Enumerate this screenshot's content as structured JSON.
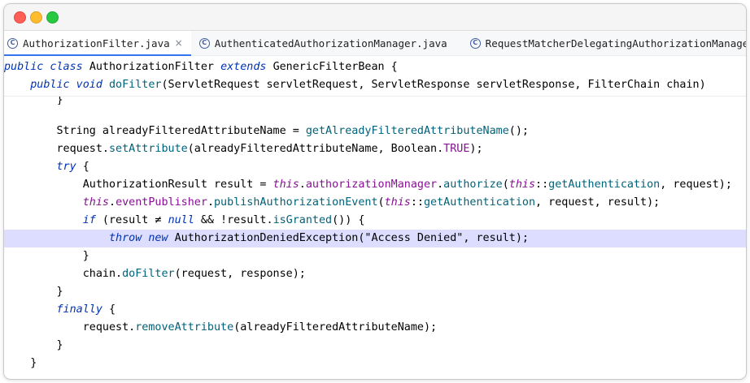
{
  "tabs": [
    {
      "label": "AuthorizationFilter.java",
      "active": true,
      "closable": true,
      "icon": "class-icon"
    },
    {
      "label": "AuthenticatedAuthorizationManager.java",
      "active": false,
      "closable": false,
      "icon": "class-icon"
    },
    {
      "label": "RequestMatcherDelegatingAuthorizationManager.java",
      "active": false,
      "closable": false,
      "icon": "class-icon"
    }
  ],
  "tab_icon_glyph": "C",
  "tab_close_glyph": "×",
  "colors": {
    "keyword": "#0033b3",
    "field": "#871094",
    "method": "#00627a",
    "string": "#067d17",
    "highlight": "#ddddff"
  },
  "sticky_lines": [
    [
      {
        "t": "public class ",
        "c": "kwi"
      },
      {
        "t": "AuthorizationFilter ",
        "c": "cls"
      },
      {
        "t": "extends ",
        "c": "kwi"
      },
      {
        "t": "GenericFilterBean {",
        "c": "cls"
      }
    ],
    [
      {
        "t": "    ",
        "c": "cls"
      },
      {
        "t": "public void ",
        "c": "kwi"
      },
      {
        "t": "doFilter",
        "c": "mth"
      },
      {
        "t": "(ServletRequest servletRequest, ServletResponse servletResponse, FilterChain chain)",
        "c": "cls"
      }
    ]
  ],
  "code_lines": [
    {
      "segs": [
        {
          "t": "        }",
          "c": "cls"
        }
      ],
      "truncated": true
    },
    {
      "segs": []
    },
    {
      "segs": [
        {
          "t": "        String alreadyFilteredAttributeName = ",
          "c": "cls"
        },
        {
          "t": "getAlreadyFilteredAttributeName",
          "c": "mth"
        },
        {
          "t": "();",
          "c": "cls"
        }
      ]
    },
    {
      "segs": [
        {
          "t": "        request.",
          "c": "cls"
        },
        {
          "t": "setAttribute",
          "c": "mth"
        },
        {
          "t": "(alreadyFilteredAttributeName, Boolean.",
          "c": "cls"
        },
        {
          "t": "TRUE",
          "c": "fld"
        },
        {
          "t": ");",
          "c": "cls"
        }
      ]
    },
    {
      "segs": [
        {
          "t": "        ",
          "c": "cls"
        },
        {
          "t": "try",
          "c": "kwi"
        },
        {
          "t": " {",
          "c": "cls"
        }
      ]
    },
    {
      "segs": [
        {
          "t": "            AuthorizationResult result = ",
          "c": "cls"
        },
        {
          "t": "this",
          "c": "kwp"
        },
        {
          "t": ".",
          "c": "cls"
        },
        {
          "t": "authorizationManager",
          "c": "fld"
        },
        {
          "t": ".",
          "c": "cls"
        },
        {
          "t": "authorize",
          "c": "mth"
        },
        {
          "t": "(",
          "c": "cls"
        },
        {
          "t": "this",
          "c": "kwp"
        },
        {
          "t": "::",
          "c": "cls"
        },
        {
          "t": "getAuthentication",
          "c": "mth"
        },
        {
          "t": ", request);",
          "c": "cls"
        }
      ]
    },
    {
      "segs": [
        {
          "t": "            ",
          "c": "cls"
        },
        {
          "t": "this",
          "c": "kwp"
        },
        {
          "t": ".",
          "c": "cls"
        },
        {
          "t": "eventPublisher",
          "c": "fld"
        },
        {
          "t": ".",
          "c": "cls"
        },
        {
          "t": "publishAuthorizationEvent",
          "c": "mth"
        },
        {
          "t": "(",
          "c": "cls"
        },
        {
          "t": "this",
          "c": "kwp"
        },
        {
          "t": "::",
          "c": "cls"
        },
        {
          "t": "getAuthentication",
          "c": "mth"
        },
        {
          "t": ", request, result);",
          "c": "cls"
        }
      ]
    },
    {
      "segs": [
        {
          "t": "            ",
          "c": "cls"
        },
        {
          "t": "if",
          "c": "kwi"
        },
        {
          "t": " (result ≠ ",
          "c": "cls"
        },
        {
          "t": "null",
          "c": "kwi"
        },
        {
          "t": " && !result.",
          "c": "cls"
        },
        {
          "t": "isGranted",
          "c": "mth"
        },
        {
          "t": "()) {",
          "c": "cls"
        }
      ]
    },
    {
      "segs": [
        {
          "t": "                ",
          "c": "cls"
        },
        {
          "t": "throw new",
          "c": "kwi"
        },
        {
          "t": " AuthorizationDeniedException(\"Access Denied\", result);",
          "c": "cls"
        }
      ],
      "highlight": true
    },
    {
      "segs": [
        {
          "t": "            }",
          "c": "cls"
        }
      ]
    },
    {
      "segs": [
        {
          "t": "            chain.",
          "c": "cls"
        },
        {
          "t": "doFilter",
          "c": "mth"
        },
        {
          "t": "(request, response);",
          "c": "cls"
        }
      ]
    },
    {
      "segs": [
        {
          "t": "        }",
          "c": "cls"
        }
      ]
    },
    {
      "segs": [
        {
          "t": "        ",
          "c": "cls"
        },
        {
          "t": "finally",
          "c": "kwi"
        },
        {
          "t": " {",
          "c": "cls"
        }
      ]
    },
    {
      "segs": [
        {
          "t": "            request.",
          "c": "cls"
        },
        {
          "t": "removeAttribute",
          "c": "mth"
        },
        {
          "t": "(alreadyFilteredAttributeName);",
          "c": "cls"
        }
      ]
    },
    {
      "segs": [
        {
          "t": "        }",
          "c": "cls"
        }
      ]
    },
    {
      "segs": [
        {
          "t": "    }",
          "c": "cls"
        }
      ]
    }
  ]
}
